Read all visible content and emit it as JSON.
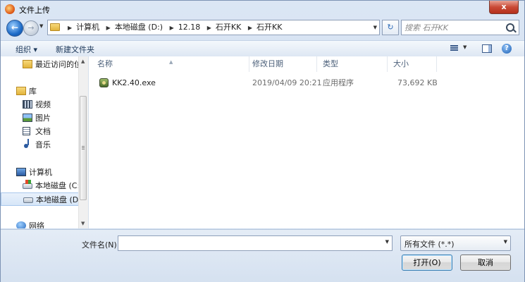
{
  "window": {
    "title": "文件上传",
    "close_label": "x"
  },
  "nav": {
    "breadcrumbs": [
      "计算机",
      "本地磁盘 (D:)",
      "12.18",
      "石开KK",
      "石开KK"
    ],
    "search_placeholder": "搜索 石开KK"
  },
  "toolbar": {
    "organize_label": "组织 ▾",
    "new_folder_label": "新建文件夹"
  },
  "sidebar": {
    "items": [
      {
        "label": "最近访问的位"
      },
      {
        "label": "库"
      },
      {
        "label": "视频"
      },
      {
        "label": "图片"
      },
      {
        "label": "文档"
      },
      {
        "label": "音乐"
      },
      {
        "label": "计算机"
      },
      {
        "label": "本地磁盘 (C:)"
      },
      {
        "label": "本地磁盘 (D:)"
      },
      {
        "label": "网络"
      }
    ]
  },
  "columns": {
    "name": "名称",
    "date": "修改日期",
    "type": "类型",
    "size": "大小"
  },
  "files": [
    {
      "name": "KK2.40.exe",
      "date": "2019/04/09 20:21",
      "type": "应用程序",
      "size": "73,692 KB"
    }
  ],
  "footer": {
    "filename_label": "文件名(N):",
    "filename_value": "",
    "filetype_value": "所有文件 (*.*)",
    "open_label": "打开(O)",
    "cancel_label": "取消"
  }
}
